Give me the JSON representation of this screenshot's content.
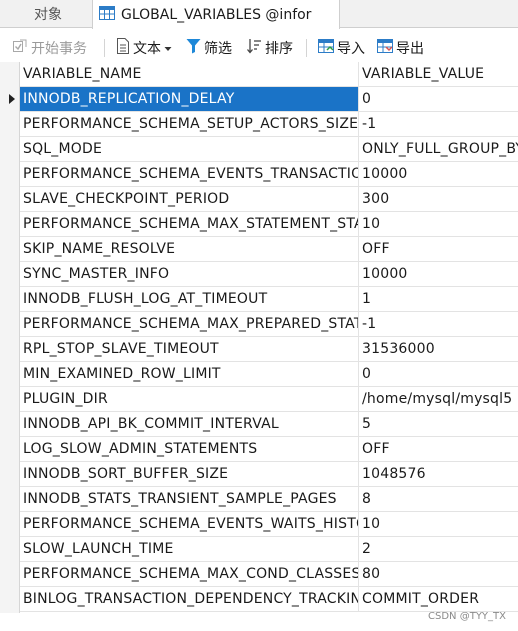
{
  "tabs": [
    {
      "label": "对象"
    },
    {
      "label": "GLOBAL_VARIABLES @infor"
    }
  ],
  "toolbar": {
    "begin_tx": "开始事务",
    "text": "文本",
    "filter": "筛选",
    "sort": "排序",
    "import": "导入",
    "export": "导出"
  },
  "grid": {
    "columns": [
      "VARIABLE_NAME",
      "VARIABLE_VALUE"
    ],
    "rows": [
      {
        "name": "INNODB_REPLICATION_DELAY",
        "value": "0"
      },
      {
        "name": "PERFORMANCE_SCHEMA_SETUP_ACTORS_SIZE",
        "value": "-1"
      },
      {
        "name": "SQL_MODE",
        "value": "ONLY_FULL_GROUP_BY"
      },
      {
        "name": "PERFORMANCE_SCHEMA_EVENTS_TRANSACTIONS",
        "value": "10000"
      },
      {
        "name": "SLAVE_CHECKPOINT_PERIOD",
        "value": "300"
      },
      {
        "name": "PERFORMANCE_SCHEMA_MAX_STATEMENT_STACK",
        "value": "10"
      },
      {
        "name": "SKIP_NAME_RESOLVE",
        "value": "OFF"
      },
      {
        "name": "SYNC_MASTER_INFO",
        "value": "10000"
      },
      {
        "name": "INNODB_FLUSH_LOG_AT_TIMEOUT",
        "value": "1"
      },
      {
        "name": "PERFORMANCE_SCHEMA_MAX_PREPARED_STATEMENTS",
        "value": "-1"
      },
      {
        "name": "RPL_STOP_SLAVE_TIMEOUT",
        "value": "31536000"
      },
      {
        "name": "MIN_EXAMINED_ROW_LIMIT",
        "value": "0"
      },
      {
        "name": "PLUGIN_DIR",
        "value": "/home/mysql/mysql5"
      },
      {
        "name": "INNODB_API_BK_COMMIT_INTERVAL",
        "value": "5"
      },
      {
        "name": "LOG_SLOW_ADMIN_STATEMENTS",
        "value": "OFF"
      },
      {
        "name": "INNODB_SORT_BUFFER_SIZE",
        "value": "1048576"
      },
      {
        "name": "INNODB_STATS_TRANSIENT_SAMPLE_PAGES",
        "value": "8"
      },
      {
        "name": "PERFORMANCE_SCHEMA_EVENTS_WAITS_HISTORY",
        "value": "10"
      },
      {
        "name": "SLOW_LAUNCH_TIME",
        "value": "2"
      },
      {
        "name": "PERFORMANCE_SCHEMA_MAX_COND_CLASSES",
        "value": "80"
      },
      {
        "name": "BINLOG_TRANSACTION_DEPENDENCY_TRACKING",
        "value": "COMMIT_ORDER"
      }
    ]
  },
  "watermark": "CSDN @TYY_TX",
  "colors": {
    "selection": "#1a73c7",
    "filter_icon": "#1e88d8"
  }
}
